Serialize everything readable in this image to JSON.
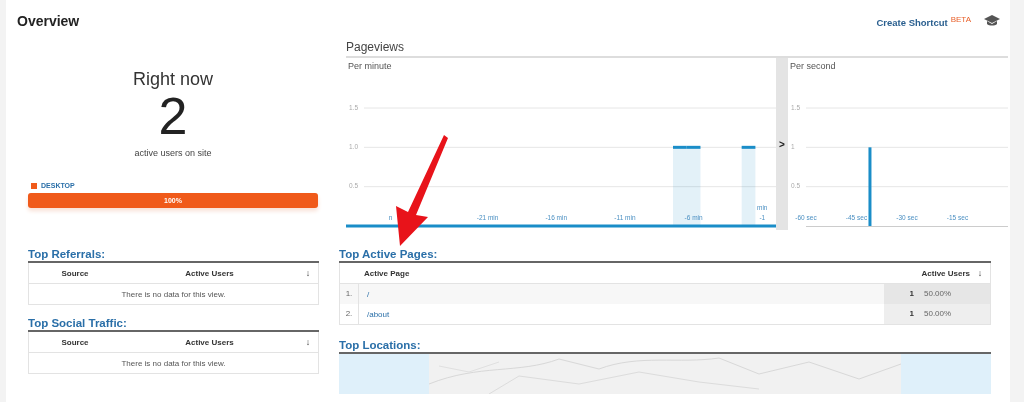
{
  "header": {
    "title": "Overview",
    "shortcut": "Create Shortcut",
    "beta": "BETA"
  },
  "right_now": {
    "title": "Right now",
    "count": "2",
    "caption": "active users on site",
    "devices": [
      {
        "label": "DESKTOP",
        "color": "#f05a1a",
        "level": 1,
        "reading": "100%"
      }
    ]
  },
  "pageviews": {
    "title": "Pageviews",
    "toggle": ">",
    "per_minute": {
      "title": "Per minute",
      "unit_label": "min",
      "cut_tick": "n",
      "chart_data": {
        "type": "bar",
        "x": [
          -7,
          -6,
          -2
        ],
        "series": [
          {
            "color": "#1a8dc8",
            "values": [
              1,
              1,
              1
            ]
          }
        ],
        "xlim": [
          -30,
          0
        ],
        "ylim": [
          0,
          1.5
        ],
        "yticks": [
          0.5,
          {
            "value": 1,
            "label": "1.0"
          },
          1.5
        ],
        "xticks": [
          {
            "value": -21,
            "label": "-21 min"
          },
          {
            "value": -16,
            "label": "-16 min"
          },
          {
            "value": -11,
            "label": "-11 min"
          },
          {
            "value": -6,
            "label": "-6 min"
          },
          {
            "value": -1,
            "label": "-1"
          }
        ]
      }
    },
    "per_second": {
      "title": "Per second",
      "chart_data": {
        "type": "bar",
        "x": [
          -41
        ],
        "series": [
          {
            "color": "#1a8dc8",
            "values": [
              1
            ]
          }
        ],
        "xlim": [
          -60,
          0
        ],
        "ylim": [
          0,
          1.5
        ],
        "yticks": [
          0.5,
          1,
          1.5
        ],
        "xticks": [
          {
            "value": -60,
            "label": "-60 sec"
          },
          {
            "value": -45,
            "label": "-45 sec"
          },
          {
            "value": -30,
            "label": "-30 sec"
          },
          {
            "value": -15,
            "label": "-15 sec"
          }
        ]
      }
    }
  },
  "top_referrals": {
    "title": "Top Referrals:",
    "columns": [
      "Source",
      "Active Users"
    ],
    "sort": "↓",
    "empty": "There is no data for this view."
  },
  "top_social": {
    "title": "Top Social Traffic:",
    "columns": [
      "Source",
      "Active Users"
    ],
    "sort": "↓",
    "empty": "There is no data for this view."
  },
  "top_pages": {
    "title": "Top Active Pages:",
    "columns": [
      "Active Page",
      "Active Users"
    ],
    "sort": "↓",
    "rows": [
      {
        "index": "1.",
        "page": "/",
        "users": "1",
        "share": "50.00%"
      },
      {
        "index": "2.",
        "page": "/about",
        "users": "1",
        "share": "50.00%"
      }
    ]
  },
  "top_locations": {
    "title": "Top Locations:"
  }
}
